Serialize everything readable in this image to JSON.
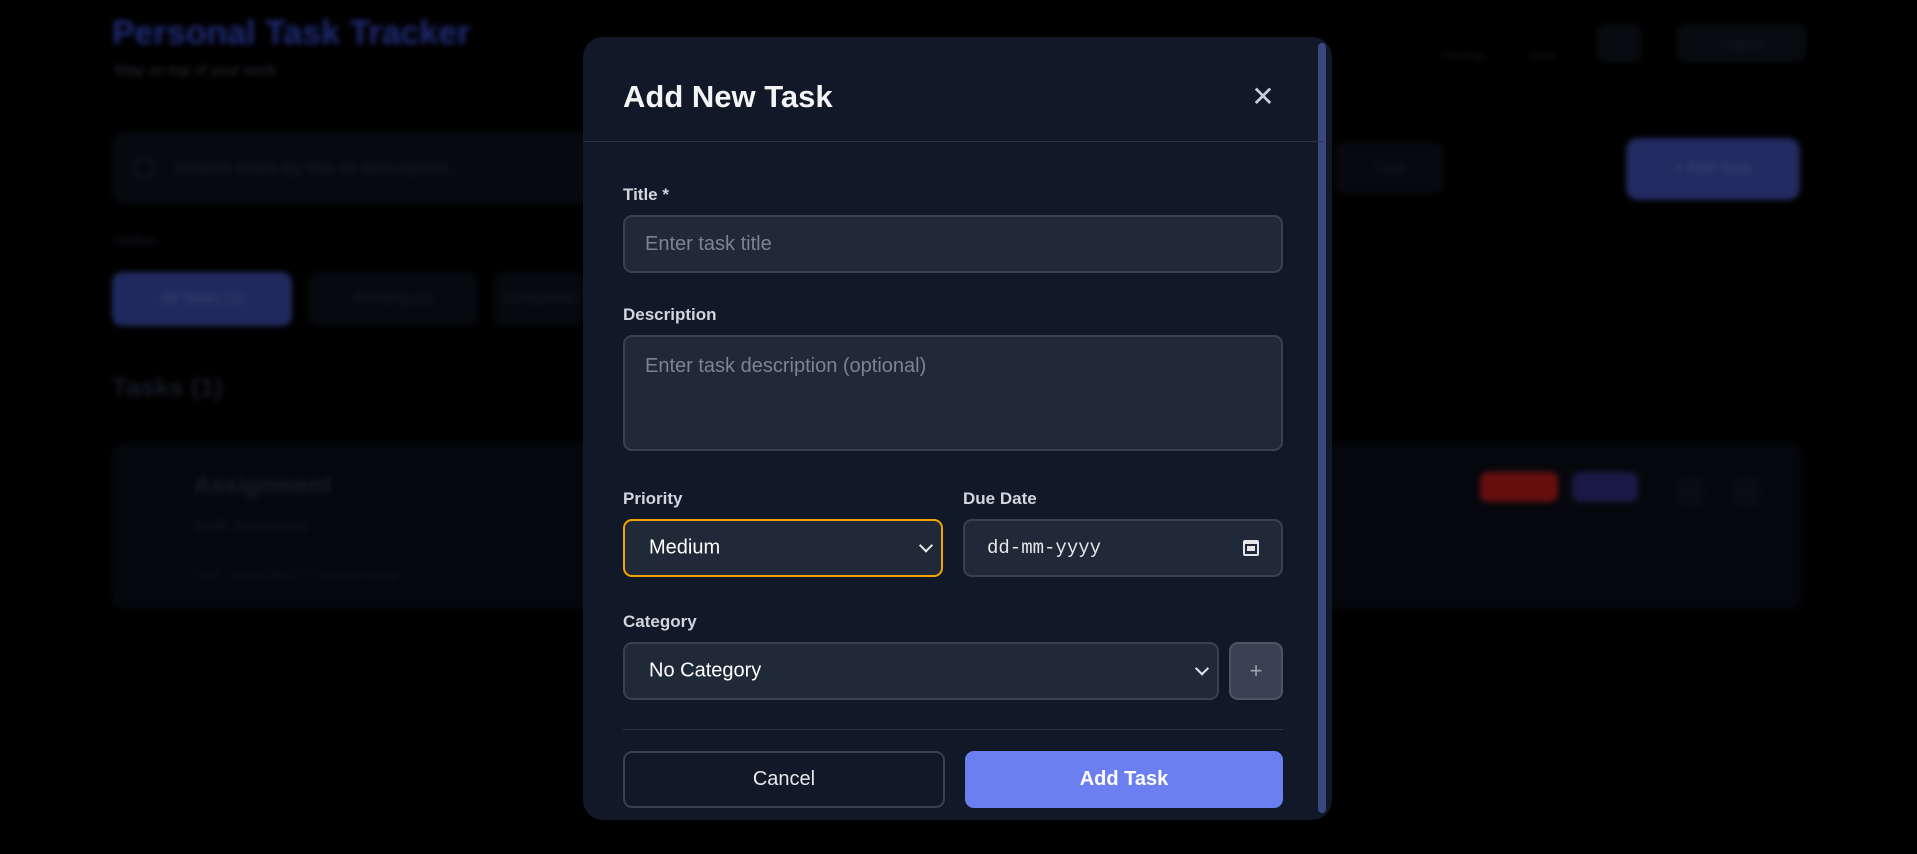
{
  "background": {
    "app_title": "Personal Task Tracker",
    "app_subtitle": "Stay on top of your work",
    "stats": [
      {
        "label": "Pending"
      },
      {
        "label": "Done"
      }
    ],
    "logout_label": "Logout",
    "search_placeholder": "Search tasks by title or description...",
    "tags_label": "Tags",
    "add_button_label": "+ Add Task",
    "status_label": "Status",
    "filters": [
      {
        "label": "All Tasks (1)",
        "active": true
      },
      {
        "label": "Pending (1)",
        "active": false
      },
      {
        "label": "Completed",
        "active": false
      }
    ],
    "tasks_heading": "Tasks (1)",
    "task": {
      "title": "Assignment",
      "description": "Math homework",
      "meta": "Due: 24/10/2025   •   Created today",
      "badges": [
        {
          "color": "#b91c1c"
        },
        {
          "color": "#3730a3"
        }
      ]
    }
  },
  "modal": {
    "title": "Add New Task",
    "close_icon": "close-icon",
    "title_label": "Title *",
    "title_placeholder": "Enter task title",
    "description_label": "Description",
    "description_placeholder": "Enter task description (optional)",
    "priority_label": "Priority",
    "priority_value": "Medium",
    "due_date_label": "Due Date",
    "due_date_placeholder": "dd-mm-yyyy",
    "category_label": "Category",
    "category_value": "No Category",
    "add_category_label": "+",
    "cancel_label": "Cancel",
    "submit_label": "Add Task",
    "colors": {
      "accent": "#6b7ff0",
      "focus_ring": "#f0a500",
      "surface": "#111827",
      "field": "#1f2937"
    }
  }
}
